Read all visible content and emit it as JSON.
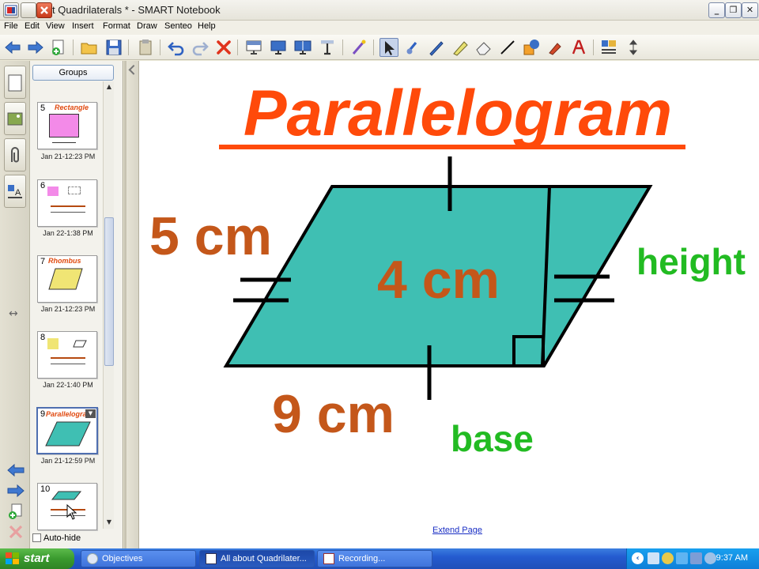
{
  "window": {
    "title": "All about Quadrilaterals * - SMART Notebook",
    "title_visible": "t Quadrilaterals * - SMART Notebook"
  },
  "menu": {
    "items": [
      "File",
      "Edit",
      "View",
      "Insert",
      "Format",
      "Draw",
      "Senteo",
      "Help"
    ]
  },
  "toolbar": {
    "icons": [
      "back-arrow-icon",
      "forward-arrow-icon",
      "add-page-icon",
      "open-folder-icon",
      "save-icon",
      "paste-icon",
      "undo-icon",
      "redo-icon",
      "delete-icon",
      "screen-shade-icon",
      "full-screen-icon",
      "dual-page-icon",
      "capture-icon",
      "magic-pen-icon",
      "select-icon",
      "creative-pen-icon",
      "pen-icon",
      "highlighter-icon",
      "eraser-icon",
      "line-icon",
      "shapes-icon",
      "fill-icon",
      "text-icon",
      "properties-icon",
      "move-toolbar-icon"
    ]
  },
  "sorter": {
    "groups_label": "Groups",
    "pages": [
      {
        "num": "5",
        "title": "Rectangle",
        "date": "Jan 21-12:23 PM",
        "selected": false
      },
      {
        "num": "6",
        "title": "",
        "date": "Jan 22-1:38 PM",
        "selected": false
      },
      {
        "num": "7",
        "title": "Rhombus",
        "date": "Jan 21-12:23 PM",
        "selected": false
      },
      {
        "num": "8",
        "title": "",
        "date": "Jan 22-1:40 PM",
        "selected": false
      },
      {
        "num": "9",
        "title": "Parallelogram",
        "date": "Jan 21-12:59 PM",
        "selected": true
      },
      {
        "num": "10",
        "title": "",
        "date": "",
        "selected": false
      }
    ],
    "autohide_label": "Auto-hide"
  },
  "slide": {
    "title": "Parallelogram",
    "side_length": "5 cm",
    "area_label": "4 cm",
    "base_length": "9 cm",
    "height_label": "height",
    "base_label": "base",
    "fill_color": "#3fbfb3",
    "title_color": "#ff4a0a",
    "measure_color": "#c4571a",
    "label_color": "#22bb22"
  },
  "extend_page_label": "Extend Page",
  "taskbar": {
    "start_label": "start",
    "tasks": [
      {
        "label": "Objectives",
        "active": false
      },
      {
        "label": "All about Quadrilater...",
        "active": true
      },
      {
        "label": "Recording...",
        "active": false
      }
    ],
    "clock": "9:37 AM"
  }
}
